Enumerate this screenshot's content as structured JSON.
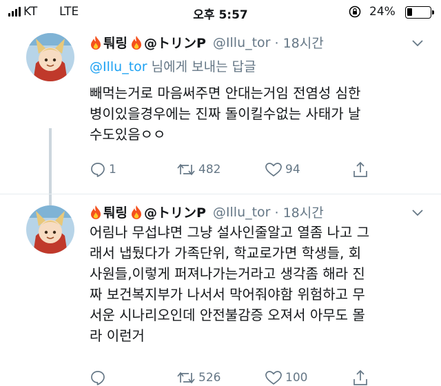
{
  "status_bar": {
    "carrier": "KT",
    "network": "LTE",
    "time": "오후 5:57",
    "battery_percent": "24%",
    "battery_level": 0.24
  },
  "tweets": [
    {
      "display_name": "퉈링",
      "handle_suffix": "@トリンP",
      "handle": "@Illu_tor",
      "time_ago": "· 18시간",
      "reply_to": {
        "mention": "@Illu_tor",
        "suffix": " 님에게 보내는 답글"
      },
      "lines": [
        "빼먹는거로 마음써주면 안대는거임 전염성 심한",
        "병이있을경우에는 진짜 돌이킬수없는 사태가 날",
        "수도있음ㅇㅇ"
      ],
      "reply_count": "1",
      "retweet_count": "482",
      "like_count": "94"
    },
    {
      "display_name": "퉈링",
      "handle_suffix": "@トリンP",
      "handle": "@Illu_tor",
      "time_ago": "· 18시간",
      "lines": [
        "어림나 무섭냐면 그냥 설사인줄알고 열좀 나고 그",
        "래서 냅뒀다가 가족단위, 학교로가면 학생들, 회",
        "사원들,이렇게 퍼져나가는거라고 생각좀 해라 진",
        "짜 보건복지부가 나서서 막어줘야함 위험하고 무",
        "서운 시나리오인데 안전불감증 오져서 아무도 몰",
        "라 이런거"
      ],
      "reply_count": "",
      "retweet_count": "526",
      "like_count": "100"
    }
  ],
  "icons": {
    "fire": "fire-emoji",
    "reply": "speech-bubble-icon",
    "retweet": "retweet-arrows-icon",
    "like": "heart-outline-icon",
    "share": "share-arrow-icon",
    "more": "chevron-down-icon"
  },
  "colors": {
    "text": "#14171a",
    "secondary": "#657786",
    "link": "#1da1f2",
    "divider": "#e6ecf0",
    "thread_line": "#ccd6dd"
  }
}
